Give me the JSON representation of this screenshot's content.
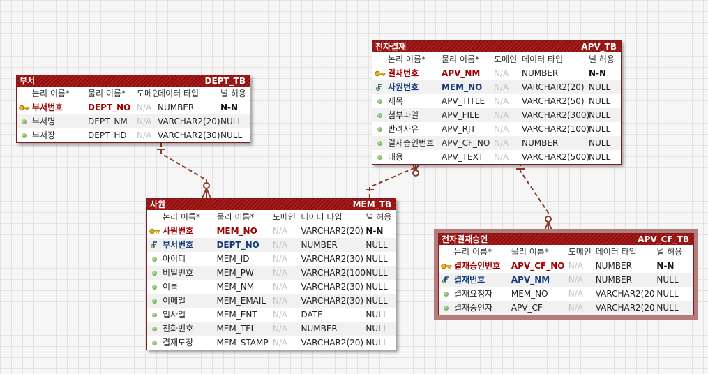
{
  "columns_header": [
    "논리 이름*",
    "물리 이름*",
    "도메인",
    "데이터 타입",
    "널 허용"
  ],
  "entities": {
    "dept": {
      "title": "부서",
      "table": "DEPT_TB",
      "rows": [
        {
          "kind": "pk",
          "logical": "부서번호",
          "physical": "DEPT_NO",
          "domain": "N/A",
          "type": "NUMBER",
          "nullable": "N-N"
        },
        {
          "kind": "col",
          "logical": "부서명",
          "physical": "DEPT_NM",
          "domain": "N/A",
          "type": "VARCHAR2(20)",
          "nullable": "NULL"
        },
        {
          "kind": "col",
          "logical": "부서장",
          "physical": "DEPT_HD",
          "domain": "N/A",
          "type": "VARCHAR2(30)",
          "nullable": "NULL"
        }
      ]
    },
    "apv": {
      "title": "전자결재",
      "table": "APV_TB",
      "rows": [
        {
          "kind": "pk",
          "logical": "결재번호",
          "physical": "APV_NM",
          "domain": "N/A",
          "type": "NUMBER",
          "nullable": "N-N"
        },
        {
          "kind": "fk",
          "logical": "사원번호",
          "physical": "MEM_NO",
          "domain": "N/A",
          "type": "VARCHAR2(20)",
          "nullable": "NULL"
        },
        {
          "kind": "col",
          "logical": "제목",
          "physical": "APV_TITLE",
          "domain": "N/A",
          "type": "VARCHAR2(50)",
          "nullable": "NULL"
        },
        {
          "kind": "col",
          "logical": "첨부파일",
          "physical": "APV_FILE",
          "domain": "N/A",
          "type": "VARCHAR2(300)",
          "nullable": "NULL"
        },
        {
          "kind": "col",
          "logical": "반려사유",
          "physical": "APV_RJT",
          "domain": "N/A",
          "type": "VARCHAR2(100)",
          "nullable": "NULL"
        },
        {
          "kind": "col",
          "logical": "결재승인번호",
          "physical": "APV_CF_NO",
          "domain": "N/A",
          "type": "NUMBER",
          "nullable": "NULL"
        },
        {
          "kind": "col",
          "logical": "내용",
          "physical": "APV_TEXT",
          "domain": "N/A",
          "type": "VARCHAR2(500)",
          "nullable": "NULL"
        }
      ]
    },
    "mem": {
      "title": "사원",
      "table": "MEM_TB",
      "rows": [
        {
          "kind": "pk",
          "logical": "사원번호",
          "physical": "MEM_NO",
          "domain": "N/A",
          "type": "VARCHAR2(20)",
          "nullable": "N-N"
        },
        {
          "kind": "fk",
          "logical": "부서번호",
          "physical": "DEPT_NO",
          "domain": "N/A",
          "type": "NUMBER",
          "nullable": "NULL"
        },
        {
          "kind": "col",
          "logical": "아이디",
          "physical": "MEM_ID",
          "domain": "N/A",
          "type": "VARCHAR2(30)",
          "nullable": "NULL"
        },
        {
          "kind": "col",
          "logical": "비밀번호",
          "physical": "MEM_PW",
          "domain": "N/A",
          "type": "VARCHAR2(100)",
          "nullable": "NULL"
        },
        {
          "kind": "col",
          "logical": "이름",
          "physical": "MEM_NM",
          "domain": "N/A",
          "type": "VARCHAR2(30)",
          "nullable": "NULL"
        },
        {
          "kind": "col",
          "logical": "이메일",
          "physical": "MEM_EMAIL",
          "domain": "N/A",
          "type": "VARCHAR2(30)",
          "nullable": "NULL"
        },
        {
          "kind": "col",
          "logical": "입사일",
          "physical": "MEM_ENT",
          "domain": "N/A",
          "type": "DATE",
          "nullable": "NULL"
        },
        {
          "kind": "col",
          "logical": "전화번호",
          "physical": "MEM_TEL",
          "domain": "N/A",
          "type": "NUMBER",
          "nullable": "NULL"
        },
        {
          "kind": "col",
          "logical": "결재도장",
          "physical": "MEM_STAMP",
          "domain": "N/A",
          "type": "VARCHAR2(20)",
          "nullable": "NULL"
        }
      ]
    },
    "apvcf": {
      "title": "전자결재승인",
      "table": "APV_CF_TB",
      "rows": [
        {
          "kind": "pk",
          "logical": "결재승인번호",
          "physical": "APV_CF_NO",
          "domain": "N/A",
          "type": "NUMBER",
          "nullable": "N-N"
        },
        {
          "kind": "fk",
          "logical": "결재번호",
          "physical": "APV_NM",
          "domain": "N/A",
          "type": "NUMBER",
          "nullable": "NULL"
        },
        {
          "kind": "col",
          "logical": "결재요청자",
          "physical": "MEM_NO",
          "domain": "N/A",
          "type": "VARCHAR2(20)",
          "nullable": "NULL"
        },
        {
          "kind": "col",
          "logical": "결재승인자",
          "physical": "APV_CF",
          "domain": "N/A",
          "type": "VARCHAR2(20)",
          "nullable": "NULL"
        }
      ]
    }
  },
  "relationships": [
    {
      "from": "dept",
      "to": "mem",
      "notation": "one-to-zero-or-many"
    },
    {
      "from": "mem",
      "to": "apv",
      "notation": "one-to-zero-or-many"
    },
    {
      "from": "apv",
      "to": "apvcf",
      "notation": "one-to-zero-or-many"
    }
  ],
  "colors": {
    "header": "#8e0c0c",
    "pk": "#a00000",
    "fk": "#163a7a",
    "line": "#8b3a2a"
  }
}
